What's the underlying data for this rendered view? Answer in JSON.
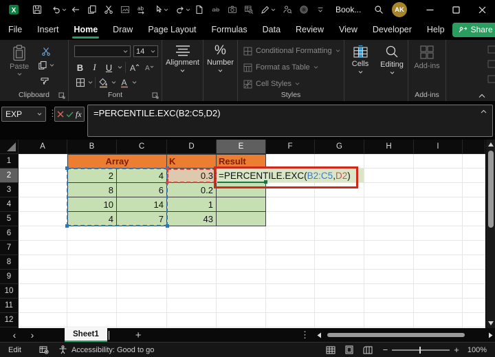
{
  "titlebar": {
    "title": "Book...",
    "avatar": "AK",
    "qat_icons": [
      "excel-logo",
      "save",
      "undo",
      "back",
      "copy",
      "cut",
      "paste-picture",
      "find-replace",
      "touch-mode",
      "redo",
      "new-file",
      "strikethrough",
      "camera",
      "sheet-lookup",
      "ink-pen",
      "person-permissions",
      "record-macro",
      "qat-overflow"
    ],
    "window_icons": [
      "search",
      "minimize",
      "maximize",
      "close"
    ],
    "find_replace_glyph": "ab",
    "strikethrough_glyph": "ab"
  },
  "tabs": {
    "items": [
      "File",
      "Insert",
      "Home",
      "Draw",
      "Page Layout",
      "Formulas",
      "Data",
      "Review",
      "View",
      "Developer",
      "Help"
    ],
    "active": "Home"
  },
  "share": {
    "label": "Share"
  },
  "ribbon": {
    "clipboard": {
      "paste": "Paste",
      "label": "Clipboard"
    },
    "font": {
      "name": "",
      "size": "14",
      "bold": "B",
      "italic": "I",
      "underline": "U",
      "label": "Font"
    },
    "alignment": {
      "label": "Alignment"
    },
    "number": {
      "label": "Number",
      "percent": "%"
    },
    "styles": {
      "items": [
        "Conditional Formatting",
        "Format as Table",
        "Cell Styles"
      ],
      "label": "Styles"
    },
    "cells": {
      "label": "Cells"
    },
    "editing": {
      "label": "Editing"
    },
    "addins": {
      "button": "Add-ins",
      "label": "Add-ins"
    }
  },
  "formula_bar": {
    "name_box": "EXP",
    "fx": "fx",
    "formula": "=PERCENTILE.EXC(B2:C5,D2)"
  },
  "grid": {
    "columns": [
      "A",
      "B",
      "C",
      "D",
      "E",
      "F",
      "G",
      "H",
      "I"
    ],
    "rows": [
      "1",
      "2",
      "3",
      "4",
      "5",
      "6",
      "7",
      "8",
      "9",
      "10",
      "11",
      "12"
    ],
    "active_column": "E",
    "active_row": "2",
    "table": {
      "array": "Array",
      "k": "K",
      "result": "Result"
    },
    "cells": {
      "b2": "2",
      "c2": "4",
      "d2": "0.3",
      "b3": "8",
      "c3": "6",
      "d3": "0.2",
      "b4": "10",
      "c4": "14",
      "d4": "1",
      "b5": "4",
      "c5": "7",
      "d5": "43"
    },
    "e2": {
      "p1": "=PERCENTILE.EXC(",
      "ref1": "B2:C5",
      "comma": ",",
      "ref2": "D2",
      "p2": ")"
    }
  },
  "sheet_bar": {
    "tab": "Sheet1",
    "add": "+",
    "more": "⋮",
    "prev": "‹",
    "next": "›"
  },
  "status_bar": {
    "mode": "Edit",
    "accessibility": "Accessibility: Good to go",
    "zoom": "100%",
    "minus": "−",
    "plus": "+"
  },
  "colors": {
    "accent_green": "#21a366",
    "header_orange": "#ED7D31",
    "header_text": "#7e1e03",
    "cell_green": "#c6e0b4",
    "d2_highlight": "#ddc9ad",
    "ref_blue": "#3e79c8",
    "ref_red": "#c9544a",
    "annotation_red": "#d2281c",
    "range_blue": "#2e75b6"
  }
}
